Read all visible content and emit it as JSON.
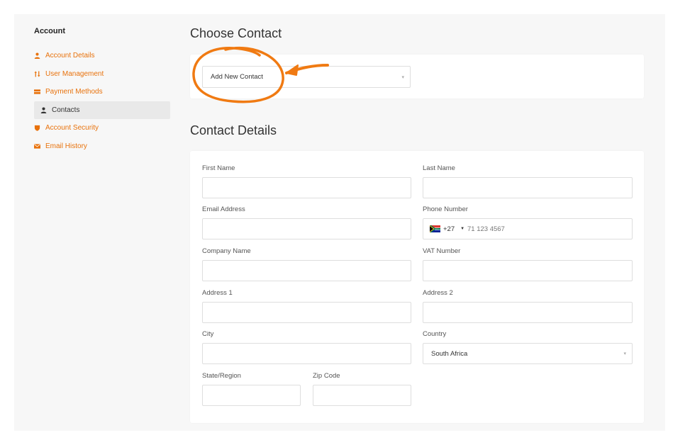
{
  "sidebar": {
    "title": "Account",
    "items": [
      {
        "label": "Account Details",
        "icon": "user-icon",
        "active": false
      },
      {
        "label": "User Management",
        "icon": "sort-arrows-icon",
        "active": false
      },
      {
        "label": "Payment Methods",
        "icon": "credit-card-icon",
        "active": false
      },
      {
        "label": "Contacts",
        "icon": "user-icon",
        "active": true
      },
      {
        "label": "Account Security",
        "icon": "shield-icon",
        "active": false
      },
      {
        "label": "Email History",
        "icon": "envelope-icon",
        "active": false
      }
    ]
  },
  "choose_contact": {
    "title": "Choose Contact",
    "select_value": "Add New Contact"
  },
  "contact_details": {
    "title": "Contact Details",
    "first_name": {
      "label": "First Name",
      "value": ""
    },
    "last_name": {
      "label": "Last Name",
      "value": ""
    },
    "email": {
      "label": "Email Address",
      "value": ""
    },
    "phone": {
      "label": "Phone Number",
      "country_code": "+27",
      "placeholder": "71 123 4567",
      "flag": "south-africa-flag-icon"
    },
    "company": {
      "label": "Company Name",
      "value": ""
    },
    "vat": {
      "label": "VAT Number",
      "value": ""
    },
    "address1": {
      "label": "Address 1",
      "value": ""
    },
    "address2": {
      "label": "Address 2",
      "value": ""
    },
    "city": {
      "label": "City",
      "value": ""
    },
    "country": {
      "label": "Country",
      "value": "South Africa"
    },
    "state": {
      "label": "State/Region",
      "value": ""
    },
    "zip": {
      "label": "Zip Code",
      "value": ""
    }
  },
  "colors": {
    "accent": "#e8720c",
    "annotation": "#f07a12",
    "panel_bg": "#f7f7f7",
    "card_bg": "#ffffff",
    "active_nav_bg": "#e9e9e9"
  }
}
